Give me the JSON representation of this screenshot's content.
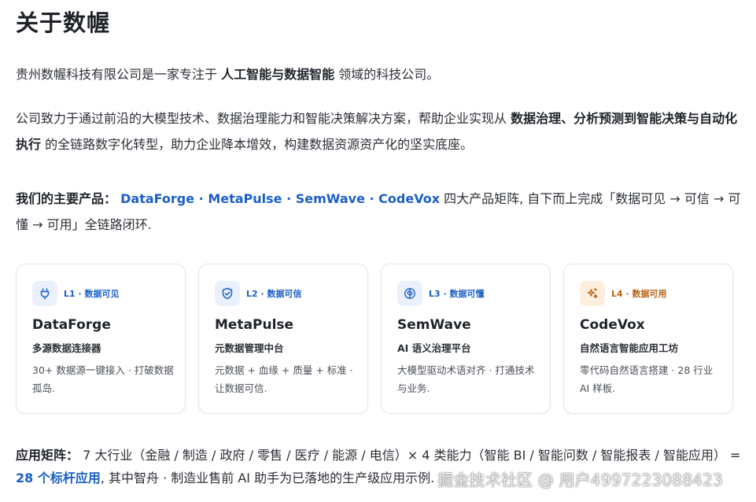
{
  "page": {
    "title": "关于数幄",
    "intro": {
      "before": "贵州数幄科技有限公司是一家专注于 ",
      "bold": "人工智能与数据智能",
      "after": " 领域的科技公司。"
    },
    "mission": {
      "before": "公司致力于通过前沿的大模型技术、数据治理能力和智能决策解决方案，帮助企业实现从 ",
      "bold": "数据治理、分析预测到智能决策与自动化执行",
      "after": " 的全链路数字化转型，助力企业降本增效，构建数据资源资产化的坚实底座。"
    },
    "products_line": {
      "label": "我们的主要产品：",
      "products": [
        "DataForge",
        "MetaPulse",
        "SemWave",
        "CodeVox"
      ],
      "separator": " · ",
      "after": " 四大产品矩阵, 自下而上完成「数据可见 → 可信 → 可懂 → 可用」全链路闭环."
    },
    "cards": [
      {
        "icon": "plug-icon",
        "level": "L1 · 数据可见",
        "name": "DataForge",
        "subtitle": "多源数据连接器",
        "desc": "30+ 数据源一键接入 · 打破数据孤岛.",
        "theme": "blue"
      },
      {
        "icon": "shield-check-icon",
        "level": "L2 · 数据可信",
        "name": "MetaPulse",
        "subtitle": "元数据管理中台",
        "desc": "元数据 + 血缘 + 质量 + 标准 · 让数据可信.",
        "theme": "blue"
      },
      {
        "icon": "brain-icon",
        "level": "L3 · 数据可懂",
        "name": "SemWave",
        "subtitle": "AI 语义治理平台",
        "desc": "大模型驱动术语对齐 · 打通技术与业务.",
        "theme": "blue"
      },
      {
        "icon": "sparkles-icon",
        "level": "L4 · 数据可用",
        "name": "CodeVox",
        "subtitle": "自然语言智能应用工坊",
        "desc": "零代码自然语言搭建 · 28 行业 AI 样板.",
        "theme": "orange"
      }
    ],
    "matrix": {
      "label": "应用矩阵：",
      "text": " 7 大行业（金融 / 制造 / 政府 / 零售 / 医疗 / 能源 / 电信）× 4 类能力（智能 BI / 智能问数 / 智能报表 / 智能应用） = ",
      "highlight": "28 个标杆应用",
      "after": ", 其中智舟 · 制造业售前 AI 助手为已落地的生产级应用示例."
    },
    "watermark": "掘金技术社区 @ 用户4997223088423",
    "colors": {
      "link": "#1a5fc7",
      "orange": "#b66216",
      "blue_bg": "#eaf1fc",
      "orange_bg": "#fdeedd"
    }
  }
}
